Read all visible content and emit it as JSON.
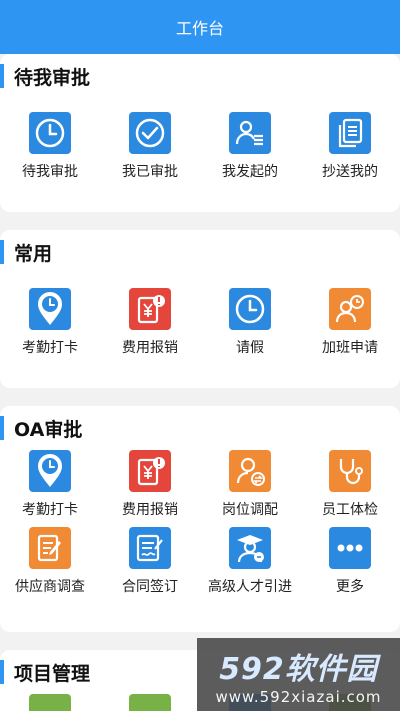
{
  "header": {
    "title": "工作台"
  },
  "sections": [
    {
      "title": "待我审批",
      "items": [
        {
          "label": "待我审批",
          "icon": "clock-icon",
          "color": "#2b8ae0"
        },
        {
          "label": "我已审批",
          "icon": "checkmark-icon",
          "color": "#2b8ae0"
        },
        {
          "label": "我发起的",
          "icon": "user-list-icon",
          "color": "#2b8ae0"
        },
        {
          "label": "抄送我的",
          "icon": "documents-icon",
          "color": "#2b8ae0"
        }
      ]
    },
    {
      "title": "常用",
      "items": [
        {
          "label": "考勤打卡",
          "icon": "location-clock-icon",
          "color": "#2b8ae0"
        },
        {
          "label": "费用报销",
          "icon": "yuan-receipt-icon",
          "color": "#e5463c"
        },
        {
          "label": "请假",
          "icon": "clock-icon",
          "color": "#2b8ae0"
        },
        {
          "label": "加班申请",
          "icon": "person-clock-icon",
          "color": "#f08a34"
        }
      ]
    },
    {
      "title": "OA审批",
      "items": [
        {
          "label": "考勤打卡",
          "icon": "location-clock-icon",
          "color": "#2b8ae0"
        },
        {
          "label": "费用报销",
          "icon": "yuan-receipt-icon",
          "color": "#e5463c"
        },
        {
          "label": "岗位调配",
          "icon": "person-swap-icon",
          "color": "#f08a34"
        },
        {
          "label": "员工体检",
          "icon": "stethoscope-icon",
          "color": "#f08a34"
        },
        {
          "label": "供应商调查",
          "icon": "edit-form-icon",
          "color": "#f08a34"
        },
        {
          "label": "合同签订",
          "icon": "sign-document-icon",
          "color": "#2b8ae0"
        },
        {
          "label": "高级人才引进",
          "icon": "graduate-icon",
          "color": "#2b8ae0"
        },
        {
          "label": "更多",
          "icon": "more-dots-icon",
          "color": "#2b8ae0"
        }
      ]
    },
    {
      "title": "项目管理",
      "items": [
        {
          "label": "",
          "icon": "project-icon",
          "color": "#78b247"
        },
        {
          "label": "",
          "icon": "project-icon",
          "color": "#78b247"
        },
        {
          "label": "",
          "icon": "project-icon",
          "color": "#2b8ae0"
        },
        {
          "label": "",
          "icon": "project-icon",
          "color": "#78b247"
        }
      ]
    }
  ],
  "watermark": {
    "brand": "592软件园",
    "url": "www.592xiazai.com"
  }
}
